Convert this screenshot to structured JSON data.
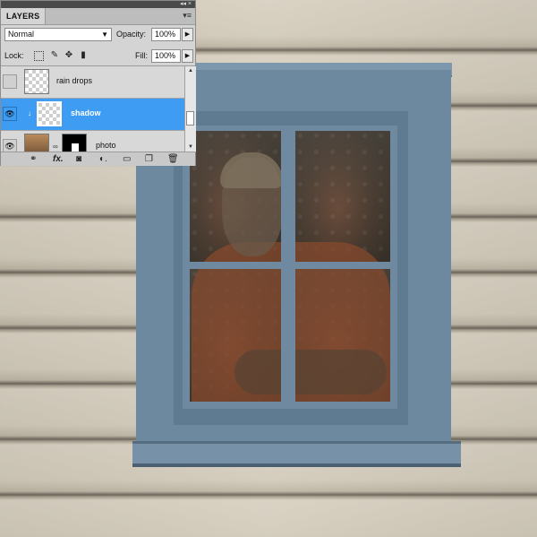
{
  "layers_panel": {
    "tab_label": "LAYERS",
    "topbar_icons": "◂◂ ×",
    "menu_icon": "▾≡",
    "blend_mode": "Normal",
    "opacity_label": "Opacity:",
    "opacity_value": "100%",
    "lock_label": "Lock:",
    "fill_label": "Fill:",
    "fill_value": "100%",
    "layers": [
      {
        "name": "rain drops",
        "visible": false,
        "selected": false
      },
      {
        "name": "shadow",
        "visible": true,
        "selected": true
      },
      {
        "name": "photo",
        "visible": true,
        "selected": false
      }
    ]
  },
  "icons": {
    "visibility": "eye-icon",
    "lock_transparent": "lock-transparent-icon",
    "lock_paint": "brush-icon",
    "lock_position": "move-icon",
    "lock_all": "lock-icon",
    "footer": [
      "link-layers-icon",
      "fx-icon",
      "mask-icon",
      "adjustment-icon",
      "folder-icon",
      "new-layer-icon",
      "trash-icon"
    ]
  },
  "colors": {
    "selected_layer": "#3e9df2",
    "window_frame": "#6d89a0",
    "siding": "#d3ccbc"
  }
}
